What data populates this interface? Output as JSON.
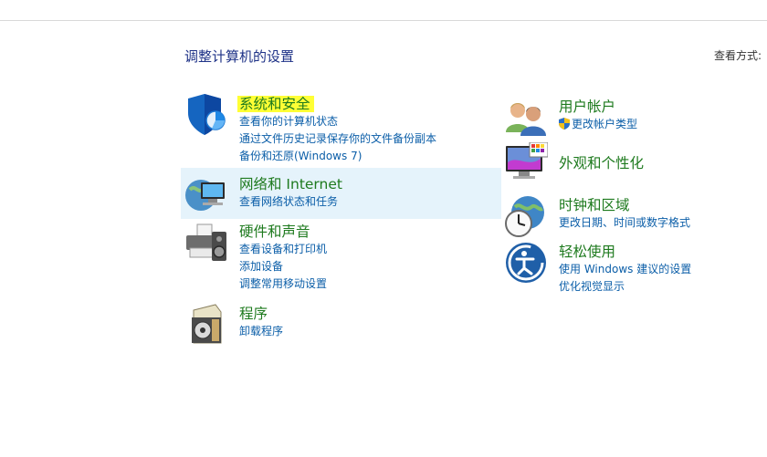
{
  "header": {
    "title": "调整计算机的设置",
    "view_by": "查看方式:"
  },
  "categories_left": [
    {
      "title": "系统和安全",
      "icon": "security-shield-icon",
      "links": [
        "查看你的计算机状态",
        "通过文件历史记录保存你的文件备份副本",
        "备份和还原(Windows 7)"
      ]
    },
    {
      "title": "网络和 Internet",
      "icon": "network-globe-icon",
      "links": [
        "查看网络状态和任务"
      ]
    },
    {
      "title": "硬件和声音",
      "icon": "printer-speaker-icon",
      "links": [
        "查看设备和打印机",
        "添加设备",
        "调整常用移动设置"
      ]
    },
    {
      "title": "程序",
      "icon": "programs-disc-icon",
      "links": [
        "卸载程序"
      ]
    }
  ],
  "categories_right": [
    {
      "title": "用户帐户",
      "icon": "users-icon",
      "links": [
        "更改帐户类型"
      ]
    },
    {
      "title": "外观和个性化",
      "icon": "monitor-palette-icon",
      "links": []
    },
    {
      "title": "时钟和区域",
      "icon": "clock-globe-icon",
      "links": [
        "更改日期、时间或数字格式"
      ]
    },
    {
      "title": "轻松使用",
      "icon": "ease-of-access-icon",
      "links": [
        "使用 Windows 建议的设置",
        "优化视觉显示"
      ]
    }
  ],
  "colors": {
    "title_green": "#1e7a1e",
    "link_blue": "#0b5ea8",
    "heading_blue": "#1e3287",
    "highlight_yellow": "#ffff35",
    "hover_bg": "#e5f3fb"
  }
}
